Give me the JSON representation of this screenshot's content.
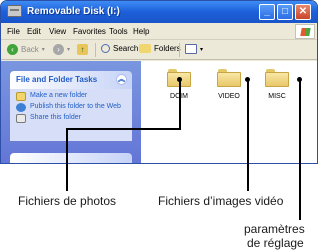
{
  "window": {
    "title": "Removable Disk (I:)",
    "controls": {
      "minimize": "_",
      "maximize": "□",
      "close": "✕"
    }
  },
  "menu": [
    "File",
    "Edit",
    "View",
    "Favorites",
    "Tools",
    "Help"
  ],
  "toolbar": {
    "back_label": "Back",
    "search_label": "Search",
    "folders_label": "Folders"
  },
  "tasks": {
    "title": "File and Folder Tasks",
    "items": [
      "Make a new folder",
      "Publish this folder to the Web",
      "Share this folder"
    ]
  },
  "folders": [
    "DCIM",
    "VIDEO",
    "MISC"
  ],
  "annotations": {
    "photos": "Fichiers de photos",
    "video": "Fichiers d’images vidéo",
    "settings_line1": "paramètres",
    "settings_line2": "de réglage"
  },
  "icons": {
    "title": "drive-icon",
    "windows": "windows-logo-icon",
    "back": "back-arrow-icon",
    "forward": "forward-arrow-icon",
    "up": "up-folder-icon",
    "search": "search-icon",
    "folders": "folders-icon",
    "views": "views-icon",
    "folder": "folder-icon"
  }
}
